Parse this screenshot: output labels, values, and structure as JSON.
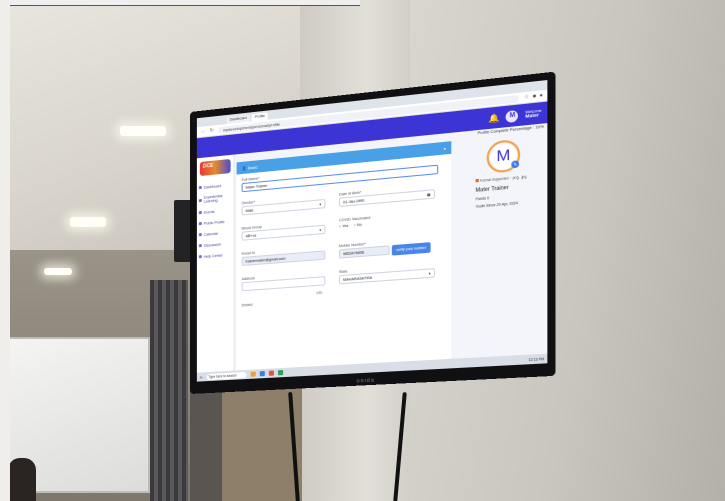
{
  "browser": {
    "tabs": [
      "Dashboard",
      "Profile"
    ],
    "address": "mydevelopment/personal/profile"
  },
  "app_header": {
    "welcome_label": "Welcome",
    "user_name": "Mater",
    "avatar_letter": "M"
  },
  "sidebar": {
    "brand": "DCE",
    "items": [
      {
        "label": "Dashboard"
      },
      {
        "label": "Experiential Learning"
      },
      {
        "label": "Events"
      },
      {
        "label": "Public Profile"
      },
      {
        "label": "Calendar"
      },
      {
        "label": "Discussion"
      },
      {
        "label": "Help Center"
      }
    ]
  },
  "content": {
    "profile_complete": "Profile Complete Percentage : 10%",
    "card_title": "Basic",
    "form": {
      "full_name_label": "Full Name*",
      "full_name_value": "Mater Trainer",
      "gender_label": "Gender*",
      "gender_value": "Male",
      "dob_label": "Date of Birth*",
      "dob_value": "01-Jan-1990",
      "blood_group_label": "Blood Group",
      "blood_group_value": "AB+ve",
      "covid_label": "COVID Vaccinated",
      "covid_yes": "Yes",
      "covid_no": "No",
      "email_label": "Email Id",
      "email_value": "trainermater@gmail.com",
      "mobile_label": "Mobile Number*",
      "mobile_value": "9853476656",
      "verify_label": "verify your number",
      "address_label": "Address",
      "address_counter": "0/80",
      "state_label": "State",
      "state_value": "MAHARASHTRA",
      "district_label": "District"
    },
    "profile_panel": {
      "avatar_letter": "M",
      "format_note": "Format Supported : .png, .jpg",
      "name": "Mater Trainer",
      "points": "Points 0",
      "youth_since": "Youth Since 20 Apr, 2024"
    }
  },
  "taskbar": {
    "search": "Type here to search",
    "time": "12:13 PM"
  },
  "tv": {
    "brand": "onida"
  }
}
